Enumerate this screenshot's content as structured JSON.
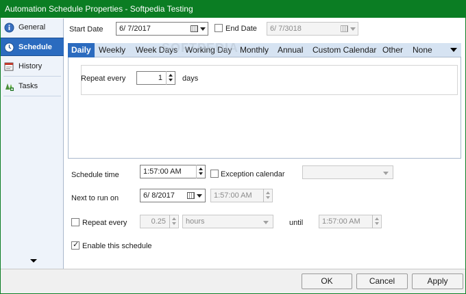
{
  "window": {
    "title": "Automation Schedule Properties - Softpedia Testing"
  },
  "watermark": "SOFTPEDIA",
  "sidebar": {
    "items": [
      {
        "label": "General",
        "icon": "info-icon"
      },
      {
        "label": "Schedule",
        "icon": "clock-icon"
      },
      {
        "label": "History",
        "icon": "history-icon"
      },
      {
        "label": "Tasks",
        "icon": "tasks-icon"
      }
    ],
    "active": "Schedule"
  },
  "dates": {
    "start_label": "Start Date",
    "start_value": "6/  7/2017",
    "end_label": "End Date",
    "end_value": "6/  7/3018"
  },
  "tabs": [
    "Daily",
    "Weekly",
    "Week Days",
    "Working Day",
    "Monthly",
    "Annual",
    "Custom Calendar",
    "Other",
    "None"
  ],
  "active_tab": "Daily",
  "daily": {
    "repeat_label": "Repeat every",
    "repeat_value": "1",
    "unit_label": "days"
  },
  "schedule": {
    "time_label": "Schedule time",
    "time_value": "1:57:00 AM",
    "exception_label": "Exception calendar",
    "exception_value": "",
    "next_label": "Next to run on",
    "next_date": "6/  8/2017",
    "next_time": "1:57:00 AM",
    "repeat_label": "Repeat every",
    "repeat_value": "0.25",
    "repeat_unit": "hours",
    "until_label": "until",
    "until_value": "1:57:00 AM",
    "enable_label": "Enable this schedule",
    "enable_checked": true
  },
  "buttons": {
    "ok": "OK",
    "cancel": "Cancel",
    "apply": "Apply"
  },
  "colors": {
    "title_bar": "#0b7d23",
    "accent": "#2b6bbf",
    "tab_bar": "#d6e3f2"
  }
}
